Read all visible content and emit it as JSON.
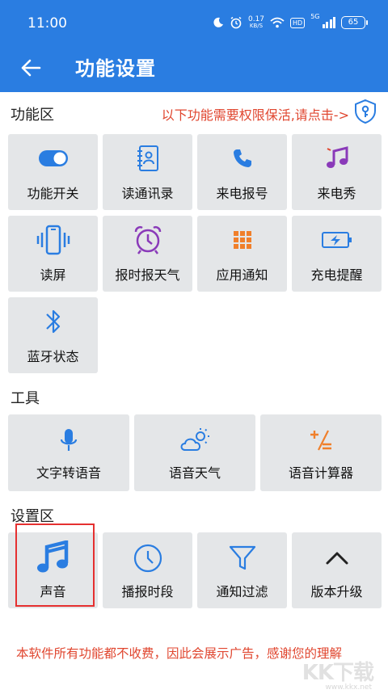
{
  "status_bar": {
    "time": "11:00",
    "net_speed_value": "0.17",
    "net_speed_unit": "KB/S",
    "hd_label": "HD",
    "network_label": "5G",
    "battery": "65"
  },
  "header": {
    "title": "功能设置",
    "back_icon": "arrow-left-icon"
  },
  "sections": {
    "features_title": "功能区",
    "permission_notice": "以下功能需要权限保活,请点击->",
    "tools_title": "工具",
    "settings_title": "设置区"
  },
  "features": [
    {
      "label": "功能开关",
      "icon": "toggle-icon"
    },
    {
      "label": "读通讯录",
      "icon": "contacts-book-icon"
    },
    {
      "label": "来电报号",
      "icon": "phone-icon"
    },
    {
      "label": "来电秀",
      "icon": "music-note-icon"
    },
    {
      "label": "读屏",
      "icon": "phone-vibrate-icon"
    },
    {
      "label": "报时报天气",
      "icon": "alarm-clock-icon"
    },
    {
      "label": "应用通知",
      "icon": "app-grid-icon"
    },
    {
      "label": "充电提醒",
      "icon": "battery-charging-icon"
    },
    {
      "label": "蓝牙状态",
      "icon": "bluetooth-icon"
    }
  ],
  "tools": [
    {
      "label": "文字转语音",
      "icon": "microphone-icon"
    },
    {
      "label": "语音天气",
      "icon": "cloud-sun-icon"
    },
    {
      "label": "语音计算器",
      "icon": "calculator-icon"
    }
  ],
  "settings": [
    {
      "label": "声音",
      "icon": "music-note-icon"
    },
    {
      "label": "播报时段",
      "icon": "clock-icon"
    },
    {
      "label": "通知过滤",
      "icon": "filter-icon"
    },
    {
      "label": "版本升级",
      "icon": "chevron-up-icon"
    }
  ],
  "footer": {
    "notice": "本软件所有功能都不收费，因此会展示广告，感谢您的理解",
    "watermark_logo": "KK下载",
    "watermark_url": "www.kkx.net"
  },
  "colors": {
    "primary": "#2a7de1",
    "notice_red": "#e0462f",
    "tile_bg": "#e4e6e8",
    "icon_purple": "#8a3ab9",
    "icon_orange": "#f07f2a",
    "highlight_red": "#e53030"
  }
}
